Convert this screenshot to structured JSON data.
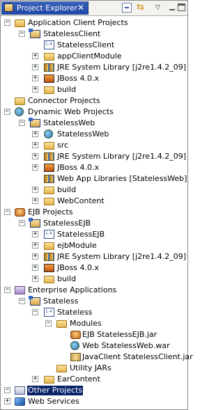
{
  "view": {
    "title": "Project Explorer",
    "close_glyph": "✕",
    "toolbar": {
      "collapse_all_icon": "collapse-all-icon",
      "link_editor_icon": "link-with-editor-icon",
      "menu_glyph": "▽"
    }
  },
  "tree": {
    "application_client_projects": "Application Client Projects",
    "stateless_client_project": "StatelessClient",
    "stateless_client_dd": "StatelessClient",
    "app_client_module": "appClientModule",
    "jre_lib_1": "JRE System Library [j2re1.4.2_09]",
    "jboss_1": "JBoss 4.0.x",
    "build_1": "build",
    "connector_projects": "Connector Projects",
    "dynamic_web_projects": "Dynamic Web Projects",
    "stateless_web_project": "StatelessWeb",
    "stateless_web_dd": "StatelessWeb",
    "src": "src",
    "jre_lib_2": "JRE System Library [j2re1.4.2_09]",
    "jboss_2": "JBoss 4.0.x",
    "web_app_libraries": "Web App Libraries [StatelessWeb]",
    "build_2": "build",
    "web_content": "WebContent",
    "ejb_projects": "EJB Projects",
    "stateless_ejb_project": "StatelessEJB",
    "stateless_ejb_dd": "StatelessEJB",
    "ejb_module": "ejbModule",
    "jre_lib_3": "JRE System Library [j2re1.4.2_09]",
    "jboss_3": "JBoss 4.0.x",
    "build_3": "build",
    "enterprise_applications": "Enterprise Applications",
    "stateless_ear_project": "Stateless",
    "stateless_ear_dd": "Stateless",
    "modules": "Modules",
    "module_ejb": "EJB StatelessEJB.jar",
    "module_web": "Web StatelessWeb.war",
    "module_client": "JavaClient StatelessClient.jar",
    "utility_jars": "Utility JARs",
    "ear_content": "EarContent",
    "other_projects": "Other Projects",
    "web_services": "Web Services"
  },
  "twisty": {
    "expanded": "−",
    "collapsed": "+"
  }
}
